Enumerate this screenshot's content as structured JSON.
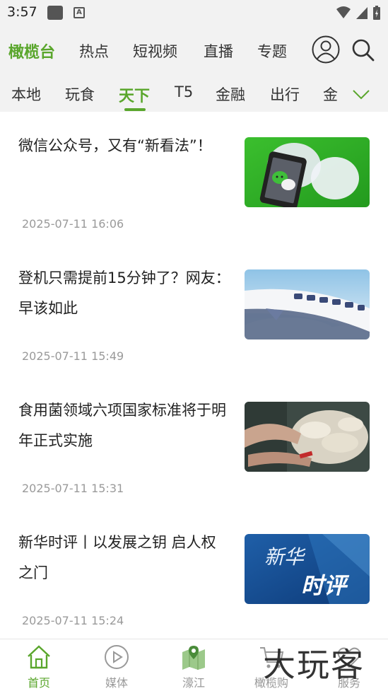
{
  "status_bar": {
    "time": "3:57"
  },
  "header": {
    "brand": "橄榄台",
    "nav_items": [
      "热点",
      "短视频",
      "直播",
      "专题"
    ]
  },
  "categories": {
    "items": [
      "本地",
      "玩食",
      "天下",
      "T5",
      "金融",
      "出行",
      "金"
    ],
    "active": "天下"
  },
  "news": [
    {
      "title": "微信公众号，又有“新看法”！",
      "date": "2025-07-11 16:06"
    },
    {
      "title": "登机只需提前15分钟了？网友：早该如此",
      "date": "2025-07-11 15:49"
    },
    {
      "title": "食用菌领域六项国家标准将于明年正式实施",
      "date": "2025-07-11 15:31"
    },
    {
      "title": "新华时评丨以发展之钥 启人权之门",
      "date": "2025-07-11 15:24"
    }
  ],
  "thumb_texts": {
    "xinhua_1": "新华",
    "xinhua_2": "时评"
  },
  "bottom_tabs": [
    {
      "label": "首页",
      "icon": "home-icon"
    },
    {
      "label": "媒体",
      "icon": "play-icon"
    },
    {
      "label": "濠江",
      "icon": "map-icon"
    },
    {
      "label": "橄榄购",
      "icon": "cart-icon"
    },
    {
      "label": "服务",
      "icon": "heart-icon"
    }
  ],
  "watermark": "大玩客",
  "colors": {
    "accent": "#5aa62c",
    "text": "#222222",
    "muted": "#9a9a9a"
  }
}
